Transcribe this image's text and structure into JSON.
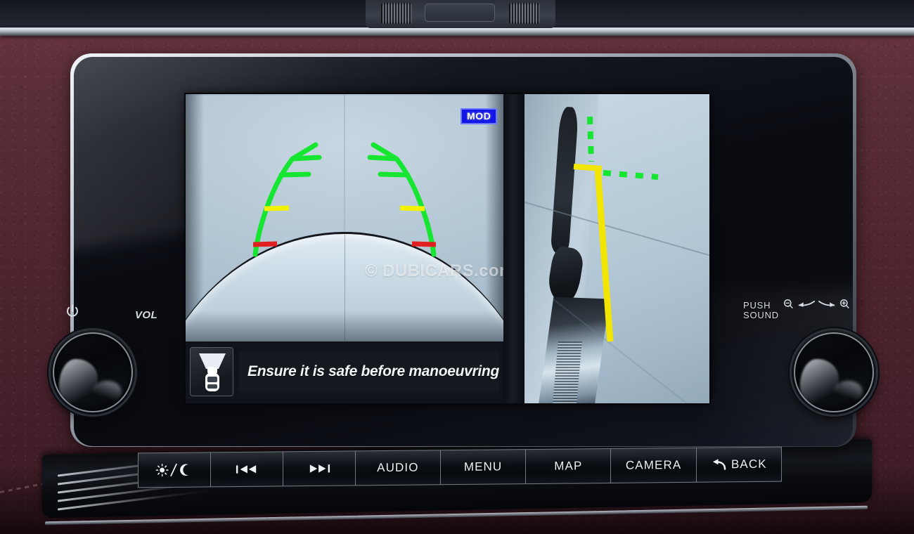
{
  "device": {
    "name": "Nissan Around View Monitor head unit",
    "screen_mode": "split rear + side camera view"
  },
  "display": {
    "mod_badge": {
      "label": "MOD",
      "bg_color": "#1116e6",
      "border_color": "#6e78ff",
      "text_color": "#ffffff"
    },
    "watermark": "© DUBICARS.com",
    "message": {
      "text": "Ensure it is safe before manoeuvring.",
      "icon": "car-camera-cone-icon"
    },
    "rear_camera": {
      "guide_colors": {
        "green": "#16e632",
        "yellow": "#f2f200",
        "red": "#e02020"
      },
      "guide_markers": [
        "green-outer-path",
        "yellow-mid-marker",
        "red-near-marker"
      ]
    },
    "side_camera": {
      "guide_colors": {
        "green_dashed": "#16e632",
        "yellow_solid": "#f2e500"
      }
    }
  },
  "left_knob": {
    "power_icon": "power-icon",
    "label": "VOL"
  },
  "right_knob": {
    "label_line1": "PUSH",
    "label_line2": "SOUND",
    "zoom_out_icon": "zoom-out-icon",
    "arrow_left_icon": "arrow-left-icon",
    "arrow_right_icon": "arrow-right-icon",
    "zoom_in_icon": "zoom-in-icon"
  },
  "hard_keys": [
    {
      "id": "daynight",
      "label": "",
      "icon": "sun-moon-icon"
    },
    {
      "id": "prev",
      "label": "",
      "icon": "previous-track-icon"
    },
    {
      "id": "next",
      "label": "",
      "icon": "next-track-icon"
    },
    {
      "id": "audio",
      "label": "AUDIO",
      "icon": ""
    },
    {
      "id": "menu",
      "label": "MENU",
      "icon": ""
    },
    {
      "id": "map",
      "label": "MAP",
      "icon": ""
    },
    {
      "id": "camera",
      "label": "CAMERA",
      "icon": ""
    },
    {
      "id": "back",
      "label": "BACK",
      "icon": "back-arrow-icon"
    }
  ]
}
